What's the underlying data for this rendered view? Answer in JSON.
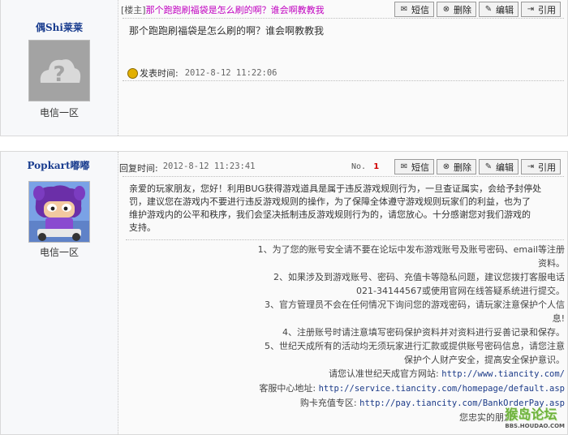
{
  "post1": {
    "username": "偶Shi莱莱",
    "region": "电信一区",
    "tag": "[楼主]",
    "subject": "那个跑跑刷福袋是怎么刷的啊？谁会啊教教我",
    "body": "那个跑跑刷福袋是怎么刷的啊？谁会啊教教我",
    "time_label": "发表时间:",
    "time": "2012-8-12 11:22:06"
  },
  "post2": {
    "username": "Popkart嘟嘟",
    "region": "电信一区",
    "time_label": "回复时间:",
    "time": "2012-8-12 11:23:41",
    "no_label": "No.",
    "no_value": "1",
    "reply_lines": [
      "亲爱的玩家朋友，您好！利用BUG获得游戏道具是属于违反游戏规则行为，一旦查证属实，会给予封停处",
      "罚，建议您在游戏内不要进行违反游戏规则的操作，为了保障全体遵守游戏规则玩家们的利益，也为了",
      "维护游戏内的公平和秩序，我们会坚决抵制违反游戏规则行为的，请您放心。十分感谢您对我们游戏的",
      "支持。"
    ],
    "notice_lines": [
      "1、为了您的账号安全请不要在论坛中发布游戏账号及账号密码、email等注册",
      "资料。",
      "2、如果涉及到游戏账号、密码、充值卡等隐私问题，建议您拨打客服电话",
      "021-34144567或使用官网在线答疑系统进行提交。",
      "3、官方管理员不会在任何情况下询问您的游戏密码，请玩家注意保护个人信",
      "息!",
      "4、注册账号时请注意填写密码保护资料并对资料进行妥善记录和保存。",
      "5、世纪天成所有的活动均无须玩家进行汇款或提供账号密码信息，请您注意",
      "保护个人财产安全，提高安全保护意识。"
    ],
    "site_label": "请您认准世纪天成官方网站:",
    "site_url": "http://www.tiancity.com/",
    "service_label": "客服中心地址:",
    "service_url": "http://service.tiancity.com/homepage/default.asp",
    "pay_label": "购卡充值专区:",
    "pay_url": "http://pay.tiancity.com/BankOrderPay.asp",
    "sign": "您忠实的朋友-"
  },
  "toolbar": {
    "sms": "短信",
    "delete": "删除",
    "edit": "编辑",
    "quote": "引用"
  },
  "watermark": {
    "text": "猴岛论坛",
    "sub": "BBS.HOUDAO.COM"
  }
}
